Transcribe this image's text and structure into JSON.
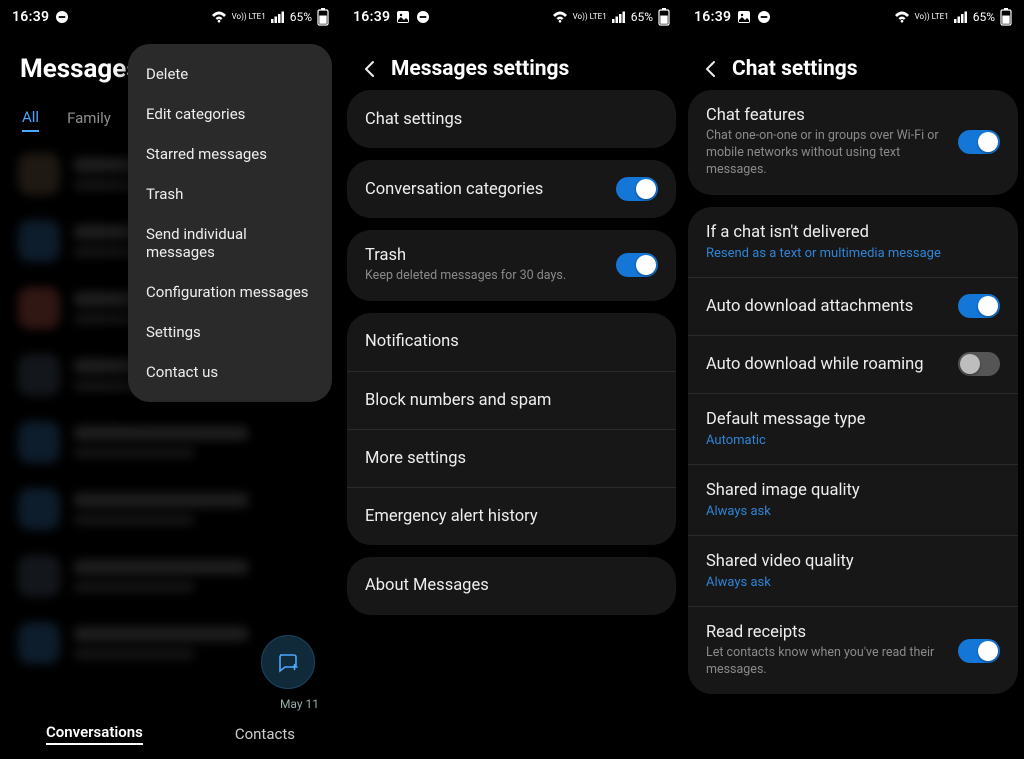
{
  "status": {
    "time": "16:39",
    "battery_text": "65%",
    "lte_label": "Vo)) LTE1"
  },
  "screen1": {
    "title": "Messages",
    "tabs": [
      "All",
      "Family"
    ],
    "menu": [
      "Delete",
      "Edit categories",
      "Starred messages",
      "Trash",
      "Send individual messages",
      "Configuration messages",
      "Settings",
      "Contact us"
    ],
    "fab_date": "May 11",
    "nav": {
      "conversations": "Conversations",
      "contacts": "Contacts"
    }
  },
  "screen2": {
    "title": "Messages settings",
    "rows": {
      "chat_settings": "Chat settings",
      "conversation_categories": "Conversation categories",
      "trash_title": "Trash",
      "trash_sub": "Keep deleted messages for 30 days.",
      "notifications": "Notifications",
      "block": "Block numbers and spam",
      "more": "More settings",
      "emergency": "Emergency alert history",
      "about": "About Messages"
    },
    "toggles": {
      "conversation_categories": true,
      "trash": true
    }
  },
  "screen3": {
    "title": "Chat settings",
    "chat_features": {
      "title": "Chat features",
      "sub": "Chat one-on-one or in groups over Wi-Fi or mobile networks without using text messages.",
      "on": true
    },
    "rows": {
      "not_delivered_title": "If a chat isn't delivered",
      "not_delivered_sub": "Resend as a text or multimedia message",
      "auto_dl": "Auto download attachments",
      "auto_dl_roaming": "Auto download while roaming",
      "default_type_title": "Default message type",
      "default_type_value": "Automatic",
      "img_quality_title": "Shared image quality",
      "img_quality_value": "Always ask",
      "vid_quality_title": "Shared video quality",
      "vid_quality_value": "Always ask",
      "read_title": "Read receipts",
      "read_sub": "Let contacts know when you've read their messages."
    },
    "toggles": {
      "auto_dl": true,
      "auto_dl_roaming": false,
      "read": true
    }
  }
}
